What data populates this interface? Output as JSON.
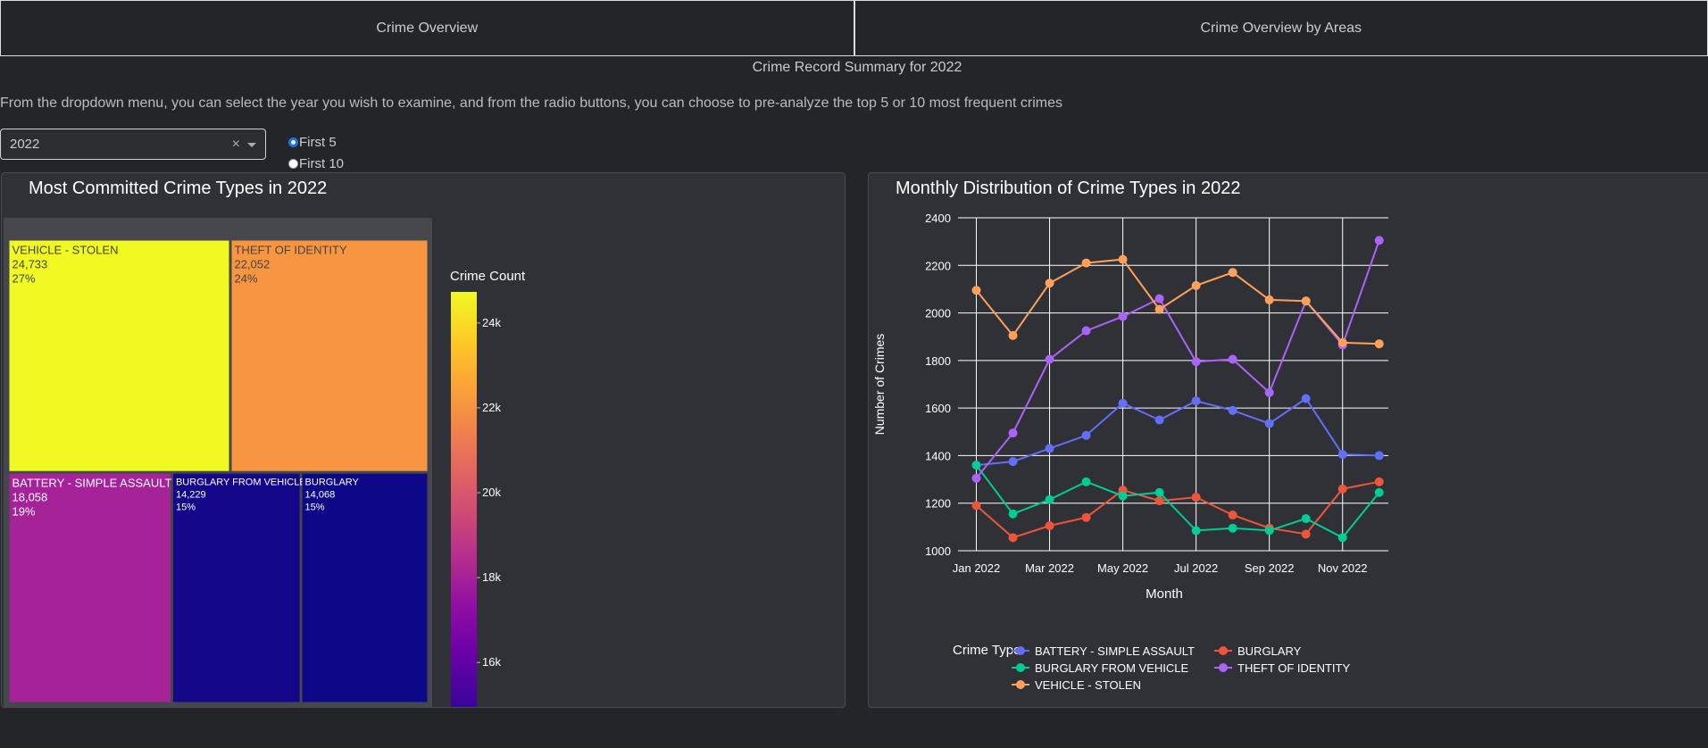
{
  "tabs": [
    {
      "label": "Crime Overview"
    },
    {
      "label": "Crime Overview by Areas"
    }
  ],
  "summary_title": "Crime Record Summary for 2022",
  "description": "From the dropdown menu, you can select the year you wish to examine, and from the radio buttons, you can choose to pre-analyze the top 5 or 10 most frequent crimes",
  "year_select": {
    "value": "2022",
    "clear_glyph": "×"
  },
  "radios": [
    {
      "label": "First 5",
      "checked": true
    },
    {
      "label": "First 10",
      "checked": false
    }
  ],
  "treemap_panel": {
    "title": "Most Committed Crime Types in 2022"
  },
  "line_panel": {
    "title": "Monthly Distribution of Crime Types in 2022"
  },
  "chart_data": [
    {
      "type": "treemap",
      "title": "Most Committed Crime Types in 2022",
      "colorbar": {
        "title": "Crime Count",
        "ticks": [
          "24k",
          "22k",
          "20k",
          "18k",
          "16k"
        ],
        "tick_values": [
          24000,
          22000,
          20000,
          18000,
          16000
        ],
        "range": [
          14068,
          24733
        ]
      },
      "items": [
        {
          "label": "VEHICLE - STOLEN",
          "value": 24733,
          "value_text": "24,733",
          "percent": "27%",
          "color": "#f0f921"
        },
        {
          "label": "THEFT OF IDENTITY",
          "value": 22052,
          "value_text": "22,052",
          "percent": "24%",
          "color": "#f89540"
        },
        {
          "label": "BATTERY - SIMPLE ASSAULT",
          "value": 18058,
          "value_text": "18,058",
          "percent": "19%",
          "color": "#a62299"
        },
        {
          "label": "BURGLARY FROM VEHICLE",
          "value": 14229,
          "value_text": "14,229",
          "percent": "15%",
          "color": "#13078a"
        },
        {
          "label": "BURGLARY",
          "value": 14068,
          "value_text": "14,068",
          "percent": "15%",
          "color": "#0d0887"
        }
      ]
    },
    {
      "type": "line",
      "title": "Monthly Distribution of Crime Types in 2022",
      "xlabel": "Month",
      "ylabel": "Number of Crimes",
      "ylim": [
        1000,
        2400
      ],
      "yticks": [
        1000,
        1200,
        1400,
        1600,
        1800,
        2000,
        2200,
        2400
      ],
      "x": [
        "Jan 2022",
        "Feb 2022",
        "Mar 2022",
        "Apr 2022",
        "May 2022",
        "Jun 2022",
        "Jul 2022",
        "Aug 2022",
        "Sep 2022",
        "Oct 2022",
        "Nov 2022",
        "Dec 2022"
      ],
      "xtick_labels": [
        "Jan 2022",
        "Mar 2022",
        "May 2022",
        "Jul 2022",
        "Sep 2022",
        "Nov 2022"
      ],
      "grid": true,
      "legend_title": "Crime Type",
      "legend_position": "bottom",
      "series": [
        {
          "name": "BATTERY - SIMPLE ASSAULT",
          "color": "#636efa",
          "values": [
            1360,
            1375,
            1430,
            1485,
            1620,
            1550,
            1630,
            1590,
            1535,
            1640,
            1405,
            1400
          ]
        },
        {
          "name": "BURGLARY",
          "color": "#ef553b",
          "values": [
            1190,
            1055,
            1105,
            1140,
            1255,
            1210,
            1225,
            1150,
            1095,
            1070,
            1260,
            1290
          ]
        },
        {
          "name": "BURGLARY FROM VEHICLE",
          "color": "#00cc96",
          "values": [
            1360,
            1155,
            1215,
            1290,
            1230,
            1245,
            1085,
            1095,
            1085,
            1135,
            1055,
            1245
          ]
        },
        {
          "name": "THEFT OF IDENTITY",
          "color": "#ab63fa",
          "values": [
            1305,
            1495,
            1805,
            1925,
            1985,
            2060,
            1795,
            1805,
            1665,
            2050,
            1865,
            2305
          ]
        },
        {
          "name": "VEHICLE - STOLEN",
          "color": "#ffa15a",
          "values": [
            2095,
            1905,
            2125,
            2210,
            2225,
            2015,
            2115,
            2170,
            2055,
            2050,
            1875,
            1870
          ]
        }
      ]
    }
  ]
}
